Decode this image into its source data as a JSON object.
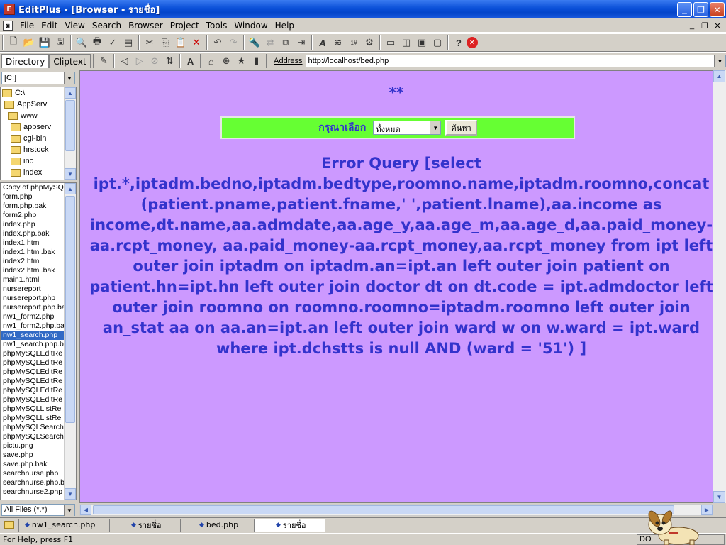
{
  "window": {
    "title": "EditPlus - [Browser - รายชื่อ]",
    "app_icon_glyph": "E"
  },
  "menu": [
    "File",
    "Edit",
    "View",
    "Search",
    "Browser",
    "Project",
    "Tools",
    "Window",
    "Help"
  ],
  "panel_tabs": {
    "directory": "Directory",
    "cliptext": "Cliptext"
  },
  "address": {
    "label": "Address",
    "value": "http://localhost/bed.php"
  },
  "drive": "[C:]",
  "dir_tree": [
    "C:\\",
    "AppServ",
    "www",
    "appserv",
    "cgi-bin",
    "hrstock",
    "inc",
    "index"
  ],
  "files": [
    "Copy of phpMySQL",
    "form.php",
    "form.php.bak",
    "form2.php",
    "index.php",
    "index.php.bak",
    "index1.html",
    "index1.html.bak",
    "index2.html",
    "index2.html.bak",
    "main1.html",
    "nursereport",
    "nursereport.php",
    "nursereport.php.ba",
    "nw1_form2.php",
    "nw1_form2.php.ba",
    "nw1_search.php",
    "nw1_search.php.b",
    "phpMySQLEditRe",
    "phpMySQLEditRe",
    "phpMySQLEditRe",
    "phpMySQLEditRe",
    "phpMySQLEditRe",
    "phpMySQLEditRe",
    "phpMySQLListRe",
    "phpMySQLListRe",
    "phpMySQLSearch",
    "phpMySQLSearch",
    "pictu.png",
    "save.php",
    "save.php.bak",
    "searchnurse.php",
    "searchnurse.php.b",
    "searchnurse2.php"
  ],
  "selected_file_index": 16,
  "file_filter": "All Files (*.*)",
  "page": {
    "stars": "**",
    "form_label": "กรุณาเลือก",
    "select_value": "ทั้งหมด",
    "search_button": "ค้นหา",
    "error_text": "Error Query [select ipt.*,iptadm.bedno,iptadm.bedtype,roomno.name,iptadm.roomno,concat (patient.pname,patient.fname,' ',patient.lname),aa.income as income,dt.name,aa.admdate,aa.age_y,aa.age_m,aa.age_d,aa.paid_money-aa.rcpt_money, aa.paid_money-aa.rcpt_money,aa.rcpt_money from ipt left outer join iptadm on iptadm.an=ipt.an left outer join patient on patient.hn=ipt.hn left outer join doctor dt on dt.code = ipt.admdoctor left outer join roomno on roomno.roomno=iptadm.roomno left outer join an_stat aa on aa.an=ipt.an left outer join ward w on w.ward = ipt.ward where ipt.dchstts is null AND (ward = '51') ]"
  },
  "doc_tabs": [
    "nw1_search.php",
    "รายชื่อ",
    "bed.php",
    "รายชื่อ"
  ],
  "active_doc_tab": 3,
  "status": {
    "message": "For Help, press F1",
    "pane": "DO"
  },
  "colors": {
    "page_bg": "#cc99ff",
    "text": "#3333cc",
    "form_bg": "#66ff33",
    "title_bar": "#0a4fd8"
  }
}
